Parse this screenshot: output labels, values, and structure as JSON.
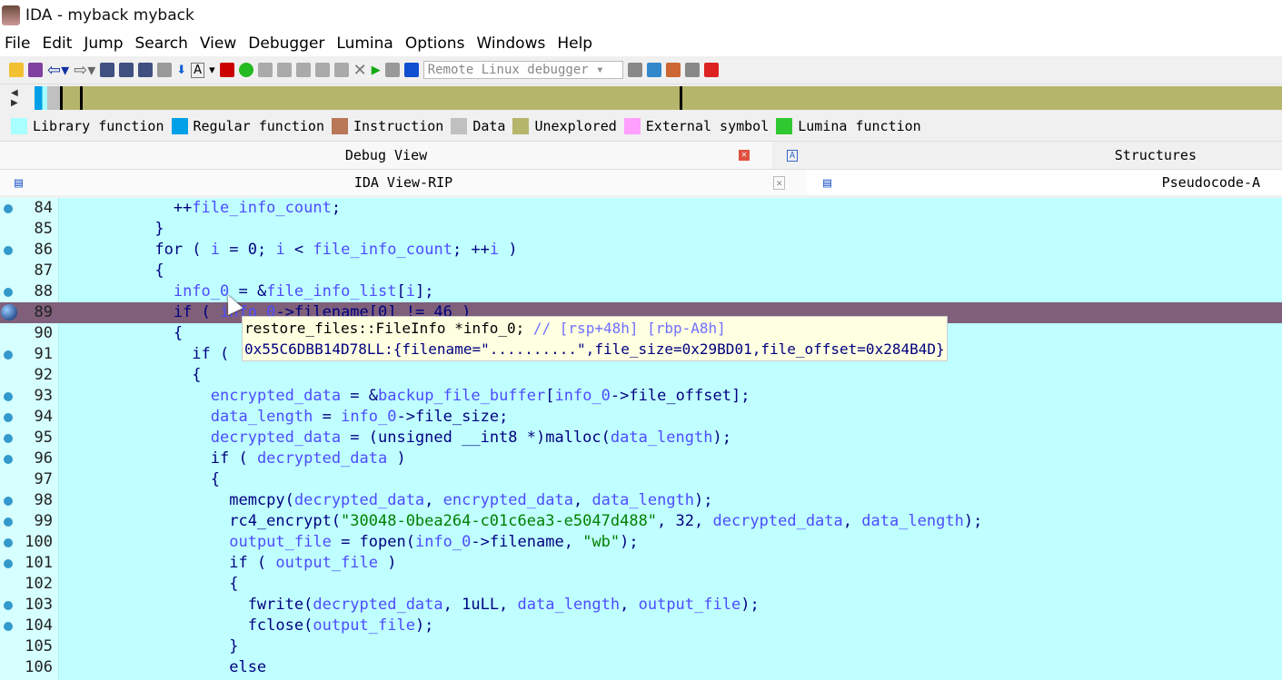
{
  "window": {
    "title": "IDA - myback myback"
  },
  "menu": [
    "File",
    "Edit",
    "Jump",
    "Search",
    "View",
    "Debugger",
    "Lumina",
    "Options",
    "Windows",
    "Help"
  ],
  "toolbar": {
    "debugger_select": "Remote Linux debugger"
  },
  "legend": [
    {
      "label": "Library function",
      "color": "#a8ffff"
    },
    {
      "label": "Regular function",
      "color": "#00a0e8"
    },
    {
      "label": "Instruction",
      "color": "#b87858"
    },
    {
      "label": "Data",
      "color": "#c0c0c0"
    },
    {
      "label": "Unexplored",
      "color": "#b5b56c"
    },
    {
      "label": "External symbol",
      "color": "#ffa0ff"
    },
    {
      "label": "Lumina function",
      "color": "#30c830"
    }
  ],
  "tabs": {
    "debug_view": "Debug View",
    "structures": "Structures",
    "ida_view": "IDA View-RIP",
    "pseudocode": "Pseudocode-A"
  },
  "code": [
    {
      "n": "84",
      "dot": true,
      "t": [
        [
          "            ++",
          ""
        ],
        [
          "file_info_count",
          "v"
        ],
        [
          ";",
          ""
        ]
      ]
    },
    {
      "n": "85",
      "dot": false,
      "t": [
        [
          "          }",
          ""
        ]
      ]
    },
    {
      "n": "86",
      "dot": true,
      "t": [
        [
          "          for ( ",
          ""
        ],
        [
          "i",
          "v"
        ],
        [
          " = 0; ",
          ""
        ],
        [
          "i",
          "v"
        ],
        [
          " < ",
          ""
        ],
        [
          "file_info_count",
          "v"
        ],
        [
          "; ++",
          ""
        ],
        [
          "i",
          "v"
        ],
        [
          " )",
          ""
        ]
      ]
    },
    {
      "n": "87",
      "dot": false,
      "t": [
        [
          "          {",
          ""
        ]
      ]
    },
    {
      "n": "88",
      "dot": true,
      "t": [
        [
          "            ",
          ""
        ],
        [
          "info_0",
          "v"
        ],
        [
          " = &",
          ""
        ],
        [
          "file_info_list",
          "v"
        ],
        [
          "[",
          ""
        ],
        [
          "i",
          "v"
        ],
        [
          "];",
          ""
        ]
      ]
    },
    {
      "n": "89",
      "dot": true,
      "cur": true,
      "t": [
        [
          "            if ( ",
          ""
        ],
        [
          "info_0",
          "v"
        ],
        [
          "->filename[0] != 46 )",
          ""
        ]
      ]
    },
    {
      "n": "90",
      "dot": false,
      "t": [
        [
          "            {",
          ""
        ]
      ]
    },
    {
      "n": "91",
      "dot": true,
      "t": [
        [
          "              if (",
          ""
        ]
      ]
    },
    {
      "n": "92",
      "dot": false,
      "t": [
        [
          "              {",
          ""
        ]
      ]
    },
    {
      "n": "93",
      "dot": true,
      "t": [
        [
          "                ",
          ""
        ],
        [
          "encrypted_data",
          "v"
        ],
        [
          " = &",
          ""
        ],
        [
          "backup_file_buffer",
          "v"
        ],
        [
          "[",
          ""
        ],
        [
          "info_0",
          "v"
        ],
        [
          "->file_offset];",
          ""
        ]
      ]
    },
    {
      "n": "94",
      "dot": true,
      "t": [
        [
          "                ",
          ""
        ],
        [
          "data_length",
          "v"
        ],
        [
          " = ",
          ""
        ],
        [
          "info_0",
          "v"
        ],
        [
          "->file_size;",
          ""
        ]
      ]
    },
    {
      "n": "95",
      "dot": true,
      "t": [
        [
          "                ",
          ""
        ],
        [
          "decrypted_data",
          "v"
        ],
        [
          " = (unsigned __int8 *)malloc(",
          ""
        ],
        [
          "data_length",
          "v"
        ],
        [
          ");",
          ""
        ]
      ]
    },
    {
      "n": "96",
      "dot": true,
      "t": [
        [
          "                if ( ",
          ""
        ],
        [
          "decrypted_data",
          "v"
        ],
        [
          " )",
          ""
        ]
      ]
    },
    {
      "n": "97",
      "dot": false,
      "t": [
        [
          "                {",
          ""
        ]
      ]
    },
    {
      "n": "98",
      "dot": true,
      "t": [
        [
          "                  memcpy(",
          ""
        ],
        [
          "decrypted_data",
          "v"
        ],
        [
          ", ",
          ""
        ],
        [
          "encrypted_data",
          "v"
        ],
        [
          ", ",
          ""
        ],
        [
          "data_length",
          "v"
        ],
        [
          ");",
          ""
        ]
      ]
    },
    {
      "n": "99",
      "dot": true,
      "t": [
        [
          "                  rc4_encrypt(",
          ""
        ],
        [
          "\"30048-0bea264-c01c6ea3-e5047d488\"",
          "s"
        ],
        [
          ", 32, ",
          ""
        ],
        [
          "decrypted_data",
          "v"
        ],
        [
          ", ",
          ""
        ],
        [
          "data_length",
          "v"
        ],
        [
          ");",
          ""
        ]
      ]
    },
    {
      "n": "100",
      "dot": true,
      "t": [
        [
          "                  ",
          ""
        ],
        [
          "output_file",
          "v"
        ],
        [
          " = fopen(",
          ""
        ],
        [
          "info_0",
          "v"
        ],
        [
          "->filename, ",
          ""
        ],
        [
          "\"wb\"",
          "s"
        ],
        [
          ");",
          ""
        ]
      ]
    },
    {
      "n": "101",
      "dot": true,
      "t": [
        [
          "                  if ( ",
          ""
        ],
        [
          "output_file",
          "v"
        ],
        [
          " )",
          ""
        ]
      ]
    },
    {
      "n": "102",
      "dot": false,
      "t": [
        [
          "                  {",
          ""
        ]
      ]
    },
    {
      "n": "103",
      "dot": true,
      "t": [
        [
          "                    fwrite(",
          ""
        ],
        [
          "decrypted_data",
          "v"
        ],
        [
          ", 1uLL, ",
          ""
        ],
        [
          "data_length",
          "v"
        ],
        [
          ", ",
          ""
        ],
        [
          "output_file",
          "v"
        ],
        [
          ");",
          ""
        ]
      ]
    },
    {
      "n": "104",
      "dot": true,
      "t": [
        [
          "                    fclose(",
          ""
        ],
        [
          "output_file",
          "v"
        ],
        [
          ");",
          ""
        ]
      ]
    },
    {
      "n": "105",
      "dot": false,
      "t": [
        [
          "                  }",
          ""
        ]
      ]
    },
    {
      "n": "106",
      "dot": false,
      "t": [
        [
          "                  else",
          ""
        ]
      ]
    }
  ],
  "tooltip": {
    "decl": "restore_files::FileInfo *info_0;",
    "comment": "// [rsp+48h] [rbp-A8h]",
    "value": "0x55C6DBB14D78LL:{filename=\"..........\",file_size=0x29BD01,file_offset=0x284B4D}"
  }
}
